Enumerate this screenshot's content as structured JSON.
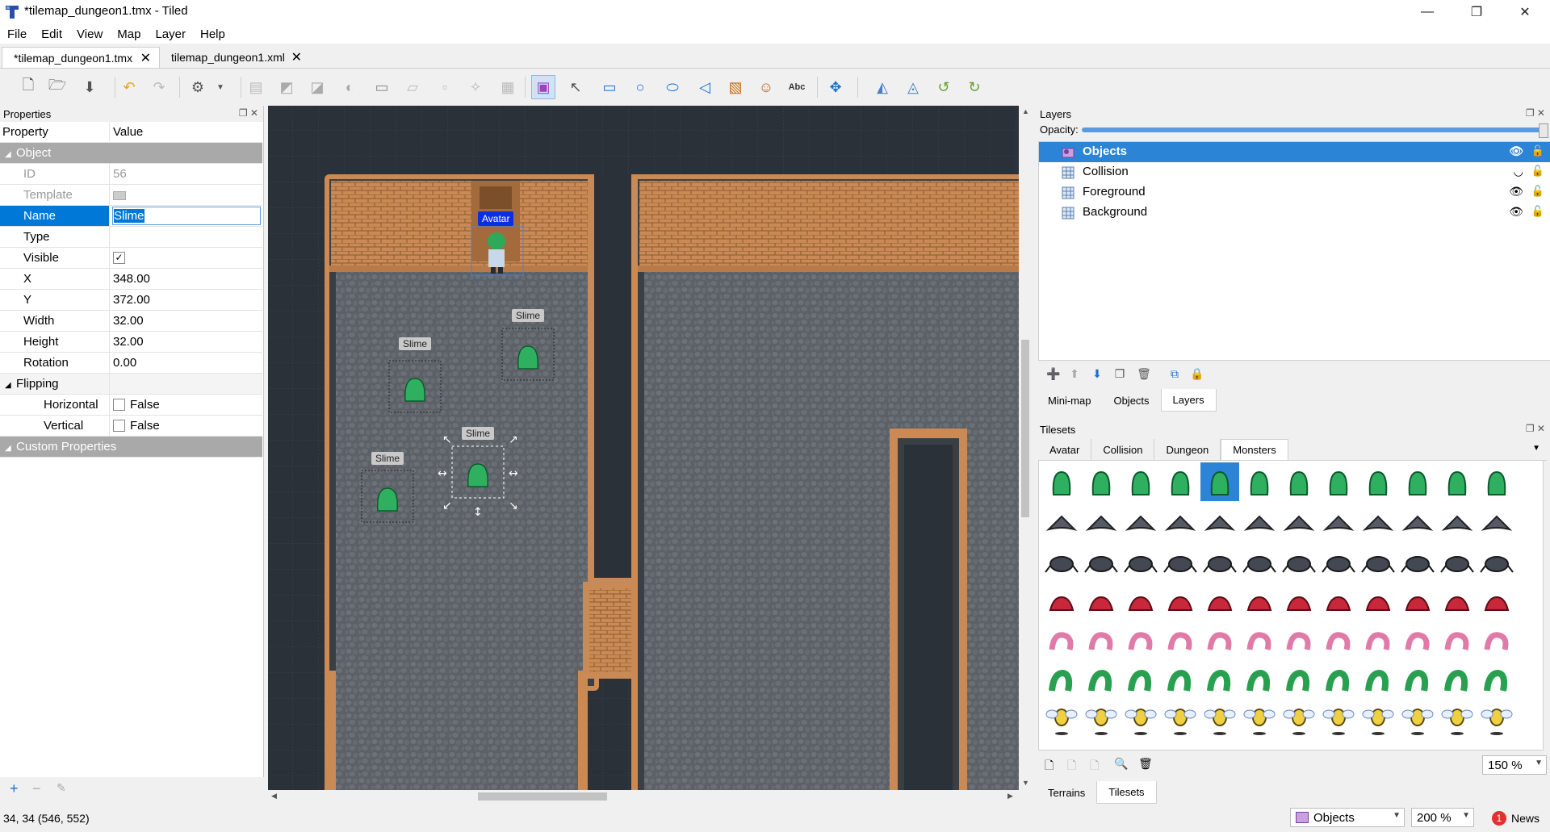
{
  "window": {
    "title": "*tilemap_dungeon1.tmx - Tiled"
  },
  "menu": [
    "File",
    "Edit",
    "View",
    "Map",
    "Layer",
    "Help"
  ],
  "tabs": [
    {
      "label": "*tilemap_dungeon1.tmx",
      "active": true
    },
    {
      "label": "tilemap_dungeon1.xml",
      "active": false
    }
  ],
  "properties_panel": {
    "title": "Properties",
    "col_property": "Property",
    "col_value": "Value",
    "group_object": "Object",
    "rows": [
      {
        "key": "ID",
        "value": "56"
      },
      {
        "key": "Template",
        "value": ""
      },
      {
        "key": "Name",
        "value": "Slime"
      },
      {
        "key": "Type",
        "value": ""
      },
      {
        "key": "Visible",
        "value": "✓"
      },
      {
        "key": "X",
        "value": "348.00"
      },
      {
        "key": "Y",
        "value": "372.00"
      },
      {
        "key": "Width",
        "value": "32.00"
      },
      {
        "key": "Height",
        "value": "32.00"
      },
      {
        "key": "Rotation",
        "value": "0.00"
      }
    ],
    "group_flipping": "Flipping",
    "flip_rows": [
      {
        "key": "Horizontal",
        "value": "False"
      },
      {
        "key": "Vertical",
        "value": "False"
      }
    ],
    "group_custom": "Custom Properties"
  },
  "map": {
    "labels": {
      "avatar": "Avatar",
      "slime1": "Slime",
      "slime2": "Slime",
      "slime3": "Slime",
      "slime4": "Slime"
    },
    "colors": {
      "grid_bg": "#2b3138",
      "wall": "#c98a55",
      "floor": "#5d6268",
      "selection": "#0a2fe0"
    }
  },
  "layers_panel": {
    "title": "Layers",
    "opacity_label": "Opacity:",
    "opacity": 1.0,
    "layers": [
      {
        "name": "Objects",
        "selected": true,
        "visible": true
      },
      {
        "name": "Collision",
        "selected": false,
        "visible": false
      },
      {
        "name": "Foreground",
        "selected": false,
        "visible": true
      },
      {
        "name": "Background",
        "selected": false,
        "visible": true
      }
    ],
    "bottom_tabs": [
      "Mini-map",
      "Objects",
      "Layers"
    ]
  },
  "tilesets_panel": {
    "title": "Tilesets",
    "tabs": [
      "Avatar",
      "Collision",
      "Dungeon",
      "Monsters"
    ],
    "active_tab": "Monsters",
    "zoom": "150 %",
    "bottom_tabs": [
      "Terrains",
      "Tilesets"
    ]
  },
  "status": {
    "coords": "34, 34 (546, 552)",
    "layer_select": "Objects",
    "zoom": "200 %",
    "news_count": "1",
    "news_label": "News"
  }
}
